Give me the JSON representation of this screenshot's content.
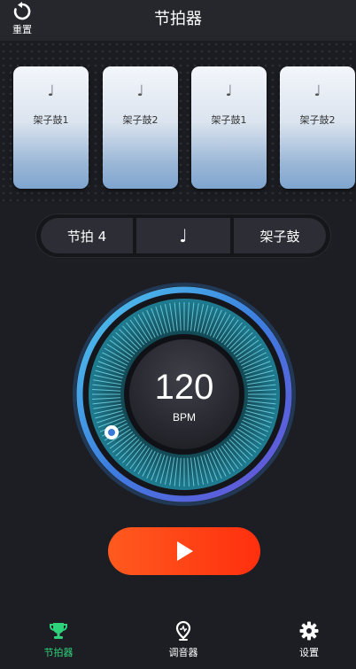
{
  "header": {
    "title": "节拍器",
    "reset_label": "重置",
    "reset_icon": "reset-icon"
  },
  "beats": [
    {
      "note": "♩",
      "label": "架子鼓1"
    },
    {
      "note": "♩",
      "label": "架子鼓2"
    },
    {
      "note": "♩",
      "label": "架子鼓1"
    },
    {
      "note": "♩",
      "label": "架子鼓2"
    }
  ],
  "controls": {
    "time_signature": "节拍 4",
    "note_value": "♩",
    "sound": "架子鼓"
  },
  "tempo": {
    "value": "120",
    "unit": "BPM"
  },
  "play": {
    "icon": "play-icon"
  },
  "tabs": [
    {
      "label": "节拍器",
      "icon": "trophy-icon",
      "active": true
    },
    {
      "label": "调音器",
      "icon": "pin-icon",
      "active": false
    },
    {
      "label": "设置",
      "icon": "gear-icon",
      "active": false
    }
  ],
  "colors": {
    "accent": "#2fd27b",
    "play": "#ff3a12",
    "dial": "#3fb8d8"
  }
}
